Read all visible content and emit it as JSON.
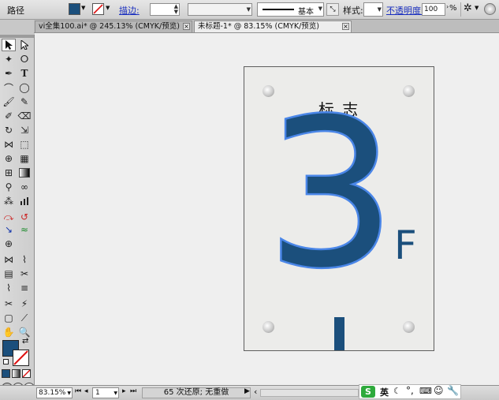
{
  "control_bar": {
    "path_label": "路径",
    "stroke_label": "描边:",
    "stroke_style": "基本",
    "style_label": "样式:",
    "opacity_label": "不透明度:",
    "opacity_value": "100",
    "percent": "%",
    "fill_color": "#1b4f7c"
  },
  "tabs": [
    {
      "label": "vi全集100.ai* @ 245.13% (CMYK/预览)",
      "active": false
    },
    {
      "label": "未标题-1* @ 83.15% (CMYK/预览)",
      "active": true
    }
  ],
  "artboard": {
    "title": "标 志",
    "big_number": "3",
    "floor_letter": "F",
    "number_color": "#1b4f7c",
    "outline_color": "#4a86e8"
  },
  "status_bar": {
    "zoom": "83.15%",
    "artboard_index": "1",
    "history": "65 次还原; 无重做"
  },
  "ime_bar": {
    "logo": "S",
    "lang": "英"
  }
}
